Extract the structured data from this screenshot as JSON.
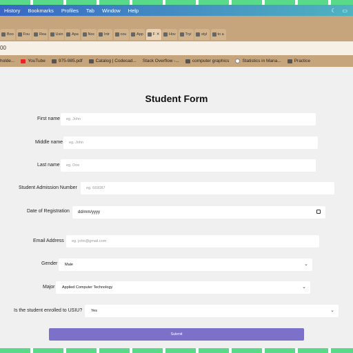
{
  "menu": {
    "items": [
      "History",
      "Bookmarks",
      "Profiles",
      "Tab",
      "Window",
      "Help"
    ]
  },
  "tabs": [
    "Boo",
    "Fou",
    "Rea",
    "Usin",
    "Apa",
    "Noc",
    "Intr",
    "cou",
    "App",
    "F",
    "Hov",
    "Tryi",
    "styl",
    "to a"
  ],
  "address": {
    "text": "00"
  },
  "bookmarks": [
    "holde...",
    "YouTube",
    "975-985.pdf",
    "Catalog | Codecad...",
    "Stack Overflow -...",
    "computer graphics",
    "Statistics in Mana...",
    "Practice"
  ],
  "form": {
    "title": "Student Form",
    "first_name": {
      "label": "First name",
      "placeholder": "eg. John"
    },
    "middle_name": {
      "label": "Middle name",
      "placeholder": "eg. John"
    },
    "last_name": {
      "label": "Last name",
      "placeholder": "eg. Doe"
    },
    "admission": {
      "label": "Student Admission Number",
      "placeholder": "eg. 669087"
    },
    "registration": {
      "label": "Date of Registration",
      "placeholder": "dd/mm/yyyy"
    },
    "email": {
      "label": "Email Address",
      "placeholder": "eg. john@gmail.com"
    },
    "gender": {
      "label": "Gender",
      "value": "Male"
    },
    "major": {
      "label": "Major",
      "value": "Applied Computer Technology"
    },
    "enrolled": {
      "label": "Is the student enrolled to USIU?",
      "value": "Yes"
    },
    "submit_label": "Submit"
  },
  "colors": {
    "menubar_start": "#3867c4",
    "menubar_end": "#4fb3c0",
    "tabbar": "#c6a57c",
    "submit": "#7b71c8",
    "strip": "#59d98a"
  }
}
